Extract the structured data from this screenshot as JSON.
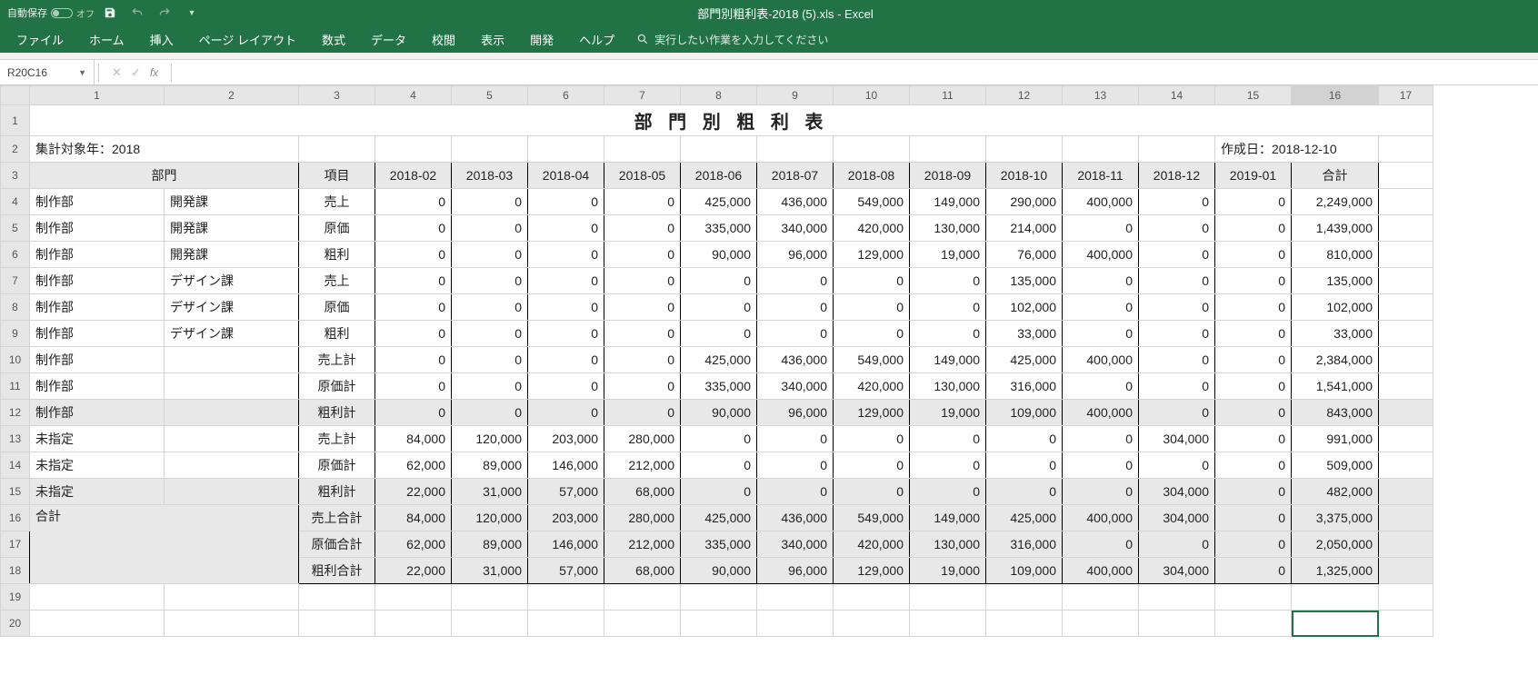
{
  "titlebar": {
    "autosave_label": "自動保存",
    "autosave_state": "オフ",
    "doc_title": "部門別粗利表-2018 (5).xls  -  Excel"
  },
  "ribbon": {
    "tabs": [
      "ファイル",
      "ホーム",
      "挿入",
      "ページ レイアウト",
      "数式",
      "データ",
      "校閲",
      "表示",
      "開発",
      "ヘルプ"
    ],
    "search_placeholder": "実行したい作業を入力してください"
  },
  "namebox": "R20C16",
  "colheaders": [
    "1",
    "2",
    "3",
    "4",
    "5",
    "6",
    "7",
    "8",
    "9",
    "10",
    "11",
    "12",
    "13",
    "14",
    "15",
    "16",
    "17"
  ],
  "sheet": {
    "title": "部 門 別 粗 利 表",
    "period_label": "集計対象年：2018",
    "created_label": "作成日：2018-12-10",
    "header": {
      "dept": "部門",
      "item": "項目",
      "months": [
        "2018-02",
        "2018-03",
        "2018-04",
        "2018-05",
        "2018-06",
        "2018-07",
        "2018-08",
        "2018-09",
        "2018-10",
        "2018-11",
        "2018-12",
        "2019-01"
      ],
      "total": "合計"
    },
    "rows": [
      {
        "d1": "制作部",
        "d2": "開発課",
        "item": "売上",
        "v": [
          "0",
          "0",
          "0",
          "0",
          "425,000",
          "436,000",
          "549,000",
          "149,000",
          "290,000",
          "400,000",
          "0",
          "0"
        ],
        "t": "2,249,000",
        "s": false
      },
      {
        "d1": "制作部",
        "d2": "開発課",
        "item": "原価",
        "v": [
          "0",
          "0",
          "0",
          "0",
          "335,000",
          "340,000",
          "420,000",
          "130,000",
          "214,000",
          "0",
          "0",
          "0"
        ],
        "t": "1,439,000",
        "s": false
      },
      {
        "d1": "制作部",
        "d2": "開発課",
        "item": "粗利",
        "v": [
          "0",
          "0",
          "0",
          "0",
          "90,000",
          "96,000",
          "129,000",
          "19,000",
          "76,000",
          "400,000",
          "0",
          "0"
        ],
        "t": "810,000",
        "s": false
      },
      {
        "d1": "制作部",
        "d2": "デザイン課",
        "item": "売上",
        "v": [
          "0",
          "0",
          "0",
          "0",
          "0",
          "0",
          "0",
          "0",
          "135,000",
          "0",
          "0",
          "0"
        ],
        "t": "135,000",
        "s": false
      },
      {
        "d1": "制作部",
        "d2": "デザイン課",
        "item": "原価",
        "v": [
          "0",
          "0",
          "0",
          "0",
          "0",
          "0",
          "0",
          "0",
          "102,000",
          "0",
          "0",
          "0"
        ],
        "t": "102,000",
        "s": false
      },
      {
        "d1": "制作部",
        "d2": "デザイン課",
        "item": "粗利",
        "v": [
          "0",
          "0",
          "0",
          "0",
          "0",
          "0",
          "0",
          "0",
          "33,000",
          "0",
          "0",
          "0"
        ],
        "t": "33,000",
        "s": false
      },
      {
        "d1": "制作部",
        "d2": "",
        "item": "売上計",
        "v": [
          "0",
          "0",
          "0",
          "0",
          "425,000",
          "436,000",
          "549,000",
          "149,000",
          "425,000",
          "400,000",
          "0",
          "0"
        ],
        "t": "2,384,000",
        "s": false
      },
      {
        "d1": "制作部",
        "d2": "",
        "item": "原価計",
        "v": [
          "0",
          "0",
          "0",
          "0",
          "335,000",
          "340,000",
          "420,000",
          "130,000",
          "316,000",
          "0",
          "0",
          "0"
        ],
        "t": "1,541,000",
        "s": false
      },
      {
        "d1": "制作部",
        "d2": "",
        "item": "粗利計",
        "v": [
          "0",
          "0",
          "0",
          "0",
          "90,000",
          "96,000",
          "129,000",
          "19,000",
          "109,000",
          "400,000",
          "0",
          "0"
        ],
        "t": "843,000",
        "s": true
      },
      {
        "d1": "未指定",
        "d2": "",
        "item": "売上計",
        "v": [
          "84,000",
          "120,000",
          "203,000",
          "280,000",
          "0",
          "0",
          "0",
          "0",
          "0",
          "0",
          "304,000",
          "0"
        ],
        "t": "991,000",
        "s": false
      },
      {
        "d1": "未指定",
        "d2": "",
        "item": "原価計",
        "v": [
          "62,000",
          "89,000",
          "146,000",
          "212,000",
          "0",
          "0",
          "0",
          "0",
          "0",
          "0",
          "0",
          "0"
        ],
        "t": "509,000",
        "s": false
      },
      {
        "d1": "未指定",
        "d2": "",
        "item": "粗利計",
        "v": [
          "22,000",
          "31,000",
          "57,000",
          "68,000",
          "0",
          "0",
          "0",
          "0",
          "0",
          "0",
          "304,000",
          "0"
        ],
        "t": "482,000",
        "s": true
      },
      {
        "d1": "合計",
        "d2": "",
        "item": "売上合計",
        "v": [
          "84,000",
          "120,000",
          "203,000",
          "280,000",
          "425,000",
          "436,000",
          "549,000",
          "149,000",
          "425,000",
          "400,000",
          "304,000",
          "0"
        ],
        "t": "3,375,000",
        "s": true,
        "merge": true
      },
      {
        "d1": "",
        "d2": "",
        "item": "原価合計",
        "v": [
          "62,000",
          "89,000",
          "146,000",
          "212,000",
          "335,000",
          "340,000",
          "420,000",
          "130,000",
          "316,000",
          "0",
          "0",
          "0"
        ],
        "t": "2,050,000",
        "s": true
      },
      {
        "d1": "",
        "d2": "",
        "item": "粗利合計",
        "v": [
          "22,000",
          "31,000",
          "57,000",
          "68,000",
          "90,000",
          "96,000",
          "129,000",
          "19,000",
          "109,000",
          "400,000",
          "304,000",
          "0"
        ],
        "t": "1,325,000",
        "s": true
      }
    ]
  }
}
